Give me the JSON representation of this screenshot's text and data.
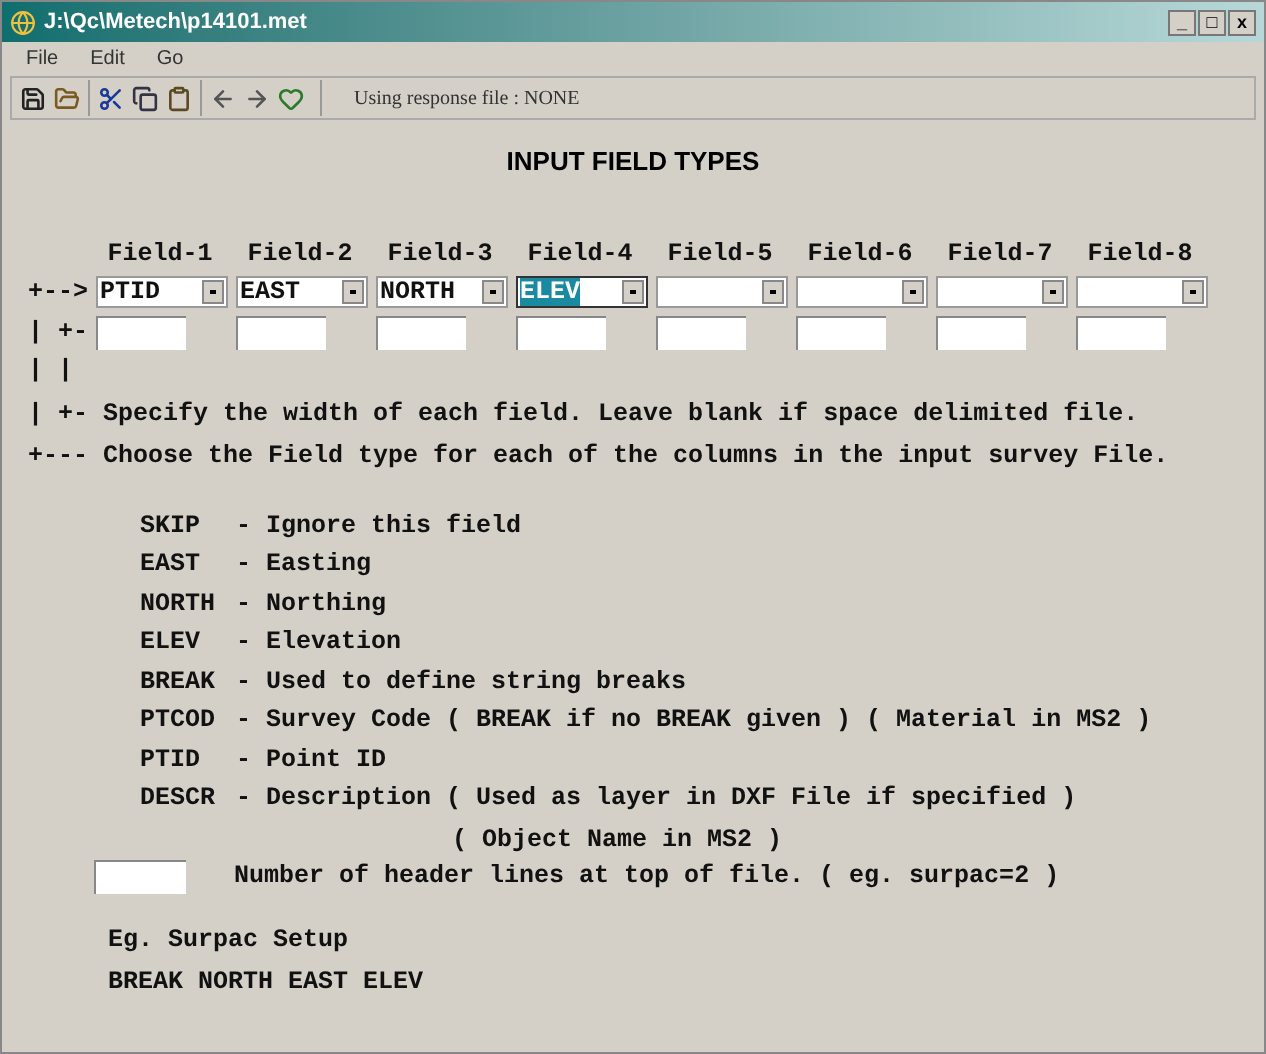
{
  "window": {
    "title": "J:\\Qc\\Metech\\p14101.met",
    "controls": [
      "_",
      "□",
      "x"
    ]
  },
  "menu": [
    "File",
    "Edit",
    "Go"
  ],
  "toolbar": {
    "status": "Using response file : NONE"
  },
  "heading": "INPUT FIELD TYPES",
  "fields": [
    {
      "label": "Field-1",
      "value": "PTID",
      "selected": false
    },
    {
      "label": "Field-2",
      "value": "EAST",
      "selected": false
    },
    {
      "label": "Field-3",
      "value": "NORTH",
      "selected": false
    },
    {
      "label": "Field-4",
      "value": "ELEV",
      "selected": true
    },
    {
      "label": "Field-5",
      "selected": false
    },
    {
      "label": "Field-6",
      "selected": false
    },
    {
      "label": "Field-7",
      "selected": false
    },
    {
      "label": "Field-8",
      "selected": false
    }
  ],
  "row_markers": [
    "+-->",
    "| +-",
    "| |"
  ],
  "notes": [
    "| +- Specify the width of each field. Leave blank if space delimited file.",
    "+--- Choose the Field type for each of the columns in the input survey File."
  ],
  "legend": [
    {
      "code": "SKIP",
      "description": "- Ignore this field"
    },
    {
      "code": "EAST",
      "description": "- Easting"
    },
    {
      "code": "NORTH",
      "description": "- Northing"
    },
    {
      "code": "ELEV",
      "description": "- Elevation"
    },
    {
      "code": "BREAK",
      "description": "- Used to define string breaks"
    },
    {
      "code": "PTCOD",
      "description": "- Survey Code ( BREAK if no BREAK given ) ( Material in MS2 )"
    },
    {
      "code": "PTID",
      "description": "- Point ID"
    },
    {
      "code": "DESCR",
      "description": "- Description ( Used as layer in DXF File if specified )",
      "continuation": "( Object Name in MS2 )"
    }
  ],
  "header_lines": {
    "label": "Number of header lines at top of file. ( eg. surpac=2 )"
  },
  "example": {
    "title": "Eg. Surpac Setup",
    "line": "BREAK NORTH EAST ELEV"
  }
}
